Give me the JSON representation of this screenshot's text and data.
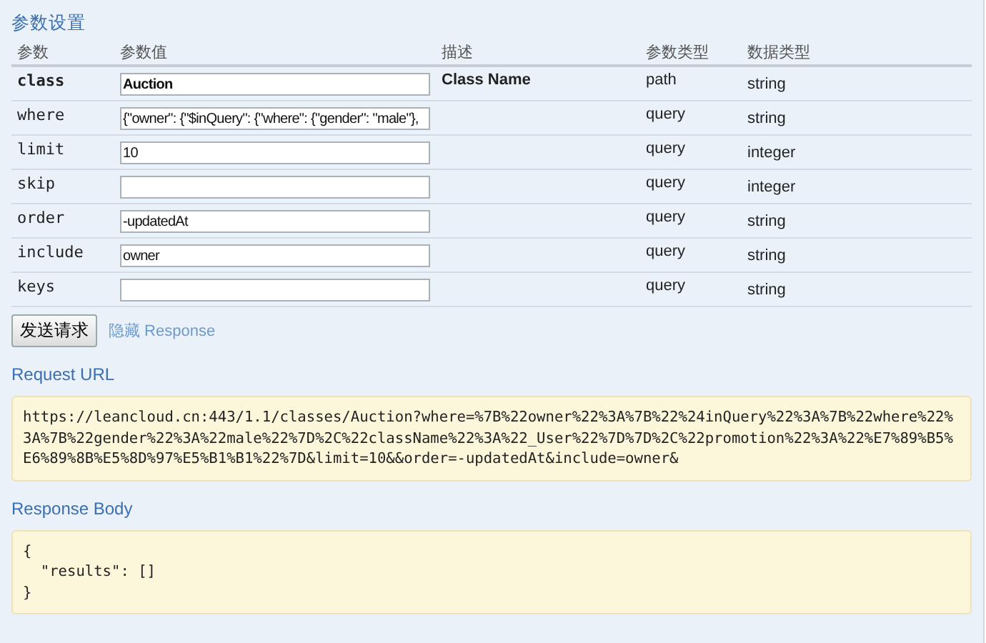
{
  "title": "参数设置",
  "columns": [
    "参数",
    "参数值",
    "描述",
    "参数类型",
    "数据类型"
  ],
  "rows": [
    {
      "name": "class",
      "value": "Auction",
      "description": "Class Name",
      "param_type": "path",
      "data_type": "string",
      "required": true
    },
    {
      "name": "where",
      "value": "{\"owner\": {\"$inQuery\": {\"where\": {\"gender\": \"male\"}, ",
      "param_type": "query",
      "data_type": "string",
      "required": false
    },
    {
      "name": "limit",
      "value": "10",
      "param_type": "query",
      "data_type": "integer",
      "required": false
    },
    {
      "name": "skip",
      "value": "",
      "param_type": "query",
      "data_type": "integer",
      "required": false
    },
    {
      "name": "order",
      "value": "-updatedAt",
      "param_type": "query",
      "data_type": "string",
      "required": false
    },
    {
      "name": "include",
      "value": "owner",
      "param_type": "query",
      "data_type": "string",
      "required": false
    },
    {
      "name": "keys",
      "value": "",
      "param_type": "query",
      "data_type": "string",
      "required": false
    }
  ],
  "submit_button": "发送请求",
  "toggle_link": "隐藏 Response",
  "sections": [
    {
      "title": "Request URL",
      "content": "https://leancloud.cn:443/1.1/classes/Auction?where=%7B%22owner%22%3A%7B%22%24inQuery%22%3A%7B%22where%22%3A%7B%22gender%22%3A%22male%22%7D%2C%22className%22%3A%22_User%22%7D%7D%2C%22promotion%22%3A%22%E7%89%B5%E6%89%8B%E5%8D%97%E5%B1%B1%22%7D&limit=10&&order=-updatedAt&include=owner&"
    },
    {
      "title": "Response Body",
      "content": "{\n  \"results\": []\n}"
    }
  ]
}
